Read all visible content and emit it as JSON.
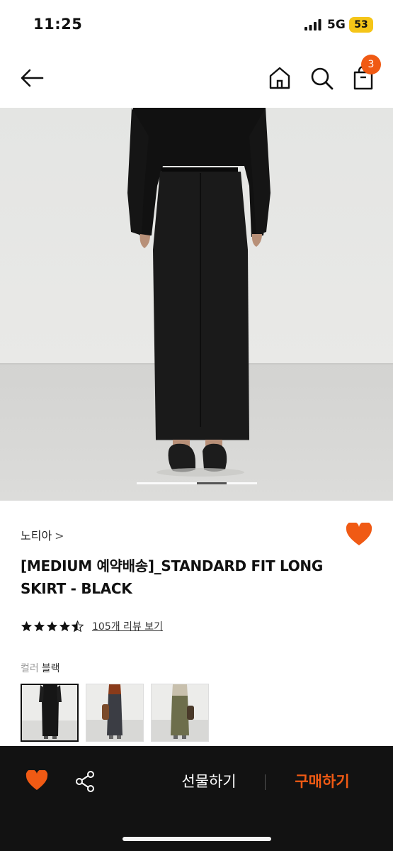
{
  "status_bar": {
    "time": "11:25",
    "network": "5G",
    "battery": "53"
  },
  "nav": {
    "cart_count": "3",
    "icons": [
      "back-arrow-icon",
      "home-icon",
      "search-icon",
      "shopping-bag-icon"
    ]
  },
  "product": {
    "brand": "노티아",
    "brand_chevron": ">",
    "title": "[MEDIUM 예약배송]_STANDARD FIT LONG SKIRT - BLACK",
    "rating": 4.5,
    "review_link": "105개 리뷰 보기",
    "color_label": "컬러",
    "color_value": "블랙",
    "swatch_count": 3,
    "wishlisted": true
  },
  "carousel": {
    "current_fraction": 0.5
  },
  "bottom_bar": {
    "gift_label": "선물하기",
    "buy_label": "구매하기"
  },
  "colors": {
    "accent": "#f05a14",
    "bottom_bar_bg": "#121212",
    "badge": "#f05a14",
    "battery": "#f5c518"
  }
}
